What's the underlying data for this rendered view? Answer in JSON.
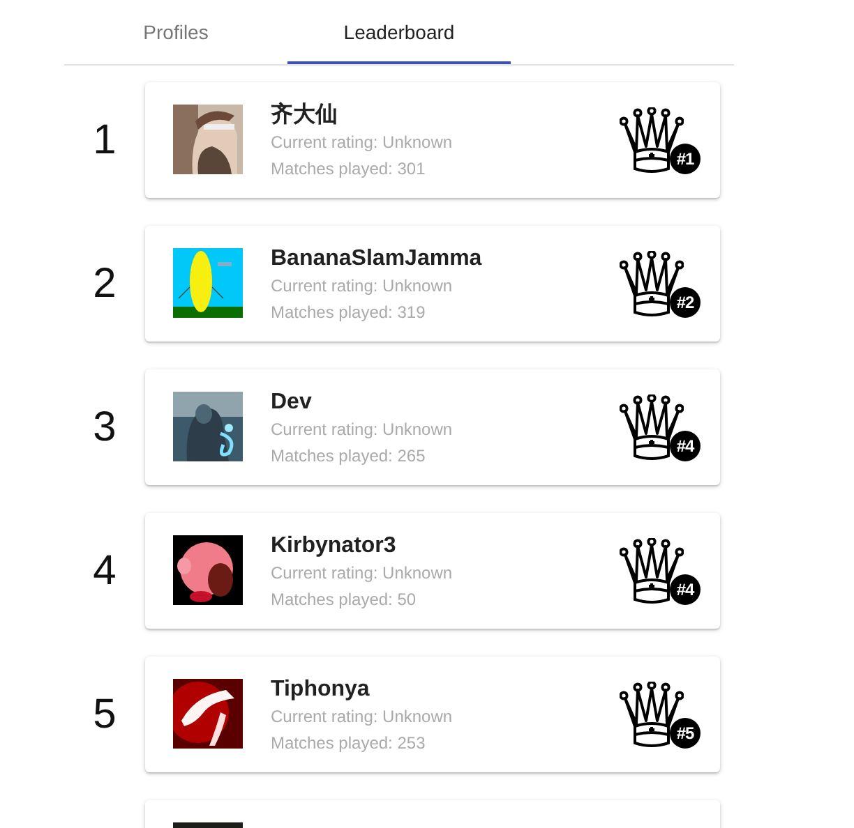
{
  "tabs": [
    {
      "label": "Profiles",
      "selected": false
    },
    {
      "label": "Leaderboard",
      "selected": true
    }
  ],
  "leaderboard": [
    {
      "kind": "player",
      "rank": "1",
      "name": "齐大仙",
      "rating": "Current rating: Unknown",
      "matches": "Matches played: 301",
      "badge": "#1"
    },
    {
      "kind": "player",
      "rank": "2",
      "name": "BananaSlamJamma",
      "rating": "Current rating: Unknown",
      "matches": "Matches played: 319",
      "badge": "#2"
    },
    {
      "kind": "player",
      "rank": "3",
      "name": "Dev",
      "rating": "Current rating: Unknown",
      "matches": "Matches played: 265",
      "badge": "#4"
    },
    {
      "kind": "player",
      "rank": "4",
      "name": "Kirbynator3",
      "rating": "Current rating: Unknown",
      "matches": "Matches played: 50",
      "badge": "#4"
    },
    {
      "kind": "player",
      "rank": "5",
      "name": "Tiphonya",
      "rating": "Current rating: Unknown",
      "matches": "Matches played: 253",
      "badge": "#5"
    },
    {
      "kind": "cut_off"
    }
  ]
}
